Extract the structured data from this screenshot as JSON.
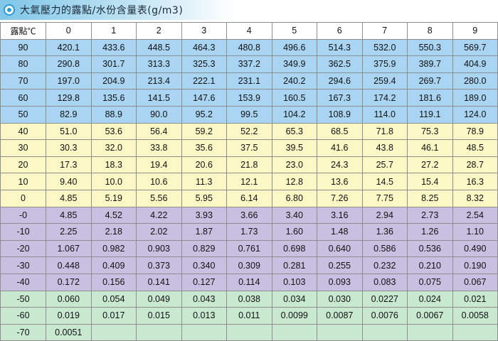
{
  "title": "大氣壓力的露點/水份含量表(g/m3)",
  "colors": {
    "blue": "#a9d5f3",
    "yellow": "#fbf8c6",
    "purple": "#c9bfe1",
    "green": "#c8e8d0"
  },
  "table": {
    "header": [
      "露點℃",
      "0",
      "1",
      "2",
      "3",
      "4",
      "5",
      "6",
      "7",
      "8",
      "9"
    ],
    "rows": [
      {
        "band": "blue",
        "cells": [
          "90",
          "420.1",
          "433.6",
          "448.5",
          "464.3",
          "480.8",
          "496.6",
          "514.3",
          "532.0",
          "550.3",
          "569.7"
        ]
      },
      {
        "band": "blue",
        "cells": [
          "80",
          "290.8",
          "301.7",
          "313.3",
          "325.3",
          "337.2",
          "349.9",
          "362.5",
          "375.9",
          "389.7",
          "404.9"
        ]
      },
      {
        "band": "blue",
        "cells": [
          "70",
          "197.0",
          "204.9",
          "213.4",
          "222.1",
          "231.1",
          "240.2",
          "294.6",
          "259.4",
          "269.7",
          "280.0"
        ]
      },
      {
        "band": "blue",
        "cells": [
          "60",
          "129.8",
          "135.6",
          "141.5",
          "147.6",
          "153.9",
          "160.5",
          "167.3",
          "174.2",
          "181.6",
          "189.0"
        ]
      },
      {
        "band": "blue",
        "cells": [
          "50",
          "82.9",
          "88.9",
          "90.0",
          "95.2",
          "99.5",
          "104.2",
          "108.9",
          "114.0",
          "119.1",
          "124.0"
        ]
      },
      {
        "band": "yellow",
        "cells": [
          "40",
          "51.0",
          "53.6",
          "56.4",
          "59.2",
          "52.2",
          "65.3",
          "68.5",
          "71.8",
          "75.3",
          "78.9"
        ]
      },
      {
        "band": "yellow",
        "cells": [
          "30",
          "30.3",
          "32.0",
          "33.8",
          "35.6",
          "37.5",
          "39.5",
          "41.6",
          "43.8",
          "46.1",
          "48.5"
        ]
      },
      {
        "band": "yellow",
        "cells": [
          "20",
          "17.3",
          "18.3",
          "19.4",
          "20.6",
          "21.8",
          "23.0",
          "24.3",
          "25.7",
          "27.2",
          "28.7"
        ]
      },
      {
        "band": "yellow",
        "cells": [
          "10",
          "9.40",
          "10.0",
          "10.6",
          "11.3",
          "12.1",
          "12.8",
          "13.6",
          "14.5",
          "15.4",
          "16.3"
        ]
      },
      {
        "band": "yellow",
        "cells": [
          "0",
          "4.85",
          "5.19",
          "5.56",
          "5.95",
          "6.14",
          "6.80",
          "7.26",
          "7.75",
          "8.25",
          "8.32"
        ]
      },
      {
        "band": "purple",
        "cells": [
          "-0",
          "4.85",
          "4.52",
          "4.22",
          "3.93",
          "3.66",
          "3.40",
          "3.16",
          "2.94",
          "2.73",
          "2.54"
        ]
      },
      {
        "band": "purple",
        "cells": [
          "-10",
          "2.25",
          "2.18",
          "2.02",
          "1.87",
          "1.73",
          "1.60",
          "1.48",
          "1.36",
          "1.26",
          "1.10"
        ]
      },
      {
        "band": "purple",
        "cells": [
          "-20",
          "1.067",
          "0.982",
          "0.903",
          "0.829",
          "0.761",
          "0.698",
          "0.640",
          "0.586",
          "0.536",
          "0.490"
        ]
      },
      {
        "band": "purple",
        "cells": [
          "-30",
          "0.448",
          "0.409",
          "0.373",
          "0.340",
          "0.309",
          "0.281",
          "0.255",
          "0.232",
          "0.210",
          "0.190"
        ]
      },
      {
        "band": "purple",
        "cells": [
          "-40",
          "0.172",
          "0.156",
          "0.141",
          "0.127",
          "0.114",
          "0.103",
          "0.093",
          "0.083",
          "0.075",
          "0.067"
        ]
      },
      {
        "band": "green",
        "cells": [
          "-50",
          "0.060",
          "0.054",
          "0.049",
          "0.043",
          "0.038",
          "0.034",
          "0.030",
          "0.0227",
          "0.024",
          "0.021"
        ]
      },
      {
        "band": "green",
        "cells": [
          "-60",
          "0.019",
          "0.017",
          "0.015",
          "0.013",
          "0.011",
          "0.0099",
          "0.0087",
          "0.0076",
          "0.0067",
          "0.0058"
        ]
      },
      {
        "band": "green",
        "cells": [
          "-70",
          "0.0051",
          "",
          "",
          "",
          "",
          "",
          "",
          "",
          "",
          ""
        ]
      }
    ]
  }
}
